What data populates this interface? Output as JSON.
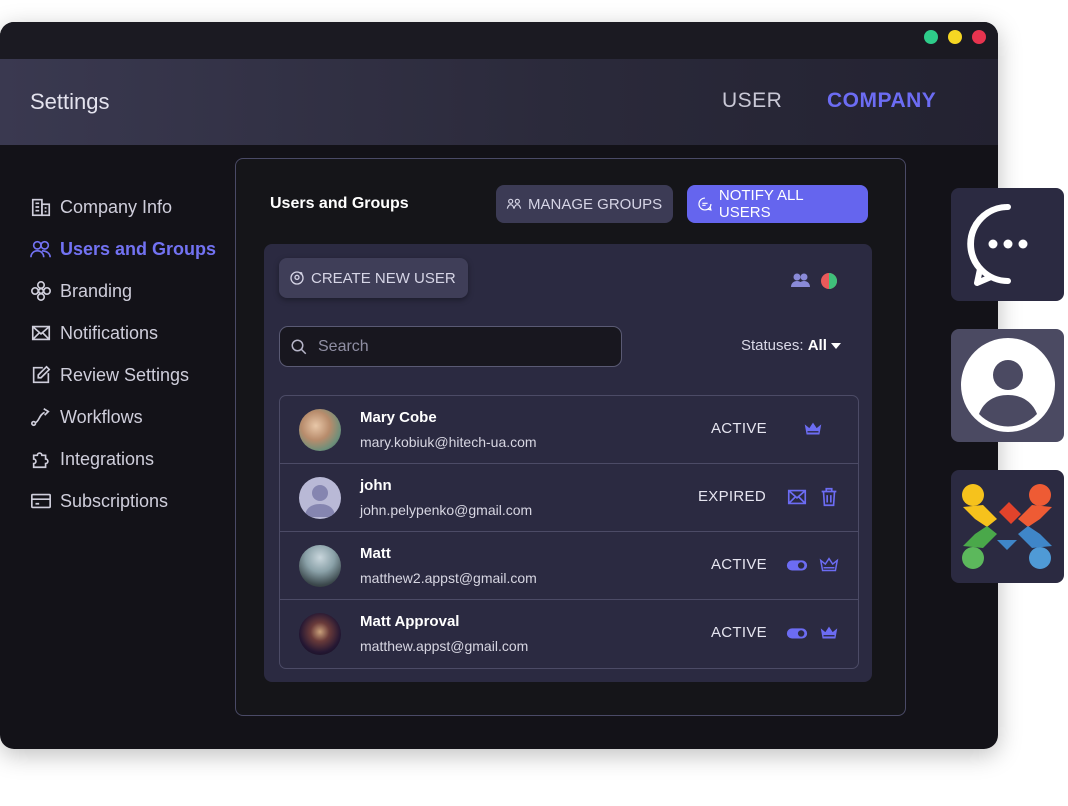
{
  "header": {
    "title": "Settings",
    "tab_user": "USER",
    "tab_company": "COMPANY"
  },
  "sidebar": {
    "items": [
      {
        "label": "Company Info",
        "icon": "building-icon"
      },
      {
        "label": "Users and Groups",
        "icon": "users-icon",
        "active": true
      },
      {
        "label": "Branding",
        "icon": "flower-icon"
      },
      {
        "label": "Notifications",
        "icon": "mail-icon"
      },
      {
        "label": "Review Settings",
        "icon": "edit-icon"
      },
      {
        "label": "Workflows",
        "icon": "workflow-icon"
      },
      {
        "label": "Integrations",
        "icon": "puzzle-icon"
      },
      {
        "label": "Subscriptions",
        "icon": "card-icon"
      }
    ]
  },
  "panel": {
    "title": "Users and Groups",
    "manage_groups": "MANAGE GROUPS",
    "notify_all": "NOTIFY ALL USERS",
    "create_user": "CREATE NEW USER",
    "search_placeholder": "Search",
    "statuses_label": "Statuses:",
    "statuses_value": "All"
  },
  "users": [
    {
      "name": "Mary Cobe",
      "email": "mary.kobiuk@hitech-ua.com",
      "status": "ACTIVE"
    },
    {
      "name": "john",
      "email": "john.pelypenko@gmail.com",
      "status": "EXPIRED"
    },
    {
      "name": "Matt",
      "email": "matthew2.appst@gmail.com",
      "status": "ACTIVE"
    },
    {
      "name": "Matt Approval",
      "email": "matthew.appst@gmail.com",
      "status": "ACTIVE"
    }
  ],
  "colors": {
    "accent": "#6565ee",
    "dot_green": "#2ecc8a",
    "dot_yellow": "#f5d623",
    "dot_red": "#e8344f"
  }
}
